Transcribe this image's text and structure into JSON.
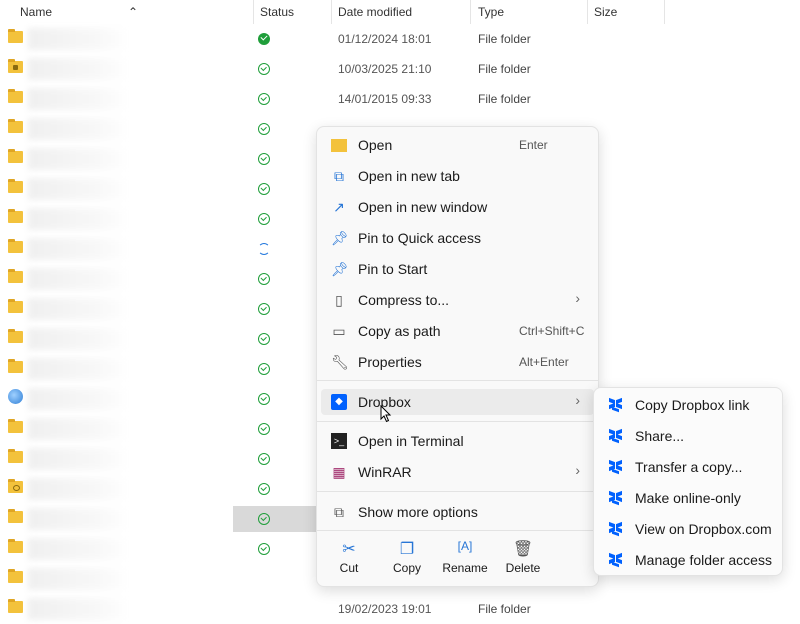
{
  "header": {
    "name": "Name",
    "status": "Status",
    "date_modified": "Date modified",
    "type": "Type",
    "size": "Size",
    "sort_indicator": "^"
  },
  "rows": [
    {
      "icon": "folder",
      "status": "synced-filled",
      "date": "01/12/2024 18:01",
      "type": "File folder"
    },
    {
      "icon": "folder-lock",
      "status": "synced",
      "date": "10/03/2025 21:10",
      "type": "File folder"
    },
    {
      "icon": "folder",
      "status": "synced",
      "date": "14/01/2015 09:33",
      "type": "File folder"
    },
    {
      "icon": "folder",
      "status": "synced"
    },
    {
      "icon": "folder",
      "status": "synced"
    },
    {
      "icon": "folder",
      "status": "synced"
    },
    {
      "icon": "folder",
      "status": "synced"
    },
    {
      "icon": "folder",
      "status": "syncing"
    },
    {
      "icon": "folder",
      "status": "synced"
    },
    {
      "icon": "folder",
      "status": "synced"
    },
    {
      "icon": "folder",
      "status": "synced"
    },
    {
      "icon": "folder",
      "status": "synced"
    },
    {
      "icon": "globe",
      "status": "synced"
    },
    {
      "icon": "folder",
      "status": "synced"
    },
    {
      "icon": "folder",
      "status": "synced"
    },
    {
      "icon": "folder-special",
      "status": "synced"
    },
    {
      "icon": "folder",
      "status": "synced",
      "selected": true
    },
    {
      "icon": "folder",
      "status": "synced"
    },
    {
      "icon": "folder",
      "status": ""
    },
    {
      "icon": "folder",
      "status": "",
      "date": "19/02/2023 19:01",
      "type": "File folder"
    }
  ],
  "context_menu": {
    "items": [
      {
        "label": "Open",
        "shortcut": "Enter",
        "icon": "folder-open-icon"
      },
      {
        "label": "Open in new tab",
        "icon": "new-tab-icon"
      },
      {
        "label": "Open in new window",
        "icon": "new-window-icon"
      },
      {
        "label": "Pin to Quick access",
        "icon": "pin-icon"
      },
      {
        "label": "Pin to Start",
        "icon": "pin-icon"
      },
      {
        "label": "Compress to...",
        "icon": "zip-icon",
        "submenu": true
      },
      {
        "label": "Copy as path",
        "shortcut": "Ctrl+Shift+C",
        "icon": "path-icon"
      },
      {
        "label": "Properties",
        "shortcut": "Alt+Enter",
        "icon": "wrench-icon"
      }
    ],
    "dropbox": {
      "label": "Dropbox"
    },
    "items2": [
      {
        "label": "Open in Terminal",
        "icon": "terminal-icon"
      },
      {
        "label": "WinRAR",
        "icon": "winrar-icon",
        "submenu": true
      }
    ],
    "show_more": "Show more options",
    "toolbar": {
      "cut": "Cut",
      "copy": "Copy",
      "rename": "Rename",
      "delete": "Delete"
    }
  },
  "dropbox_submenu": [
    "Copy Dropbox link",
    "Share...",
    "Transfer a copy...",
    "Make online-only",
    "View on Dropbox.com",
    "Manage folder access"
  ],
  "colors": {
    "accent": "#2776d6",
    "dropbox": "#0061fe",
    "synced": "#1f9e3a",
    "folder": "#f3c23c"
  }
}
